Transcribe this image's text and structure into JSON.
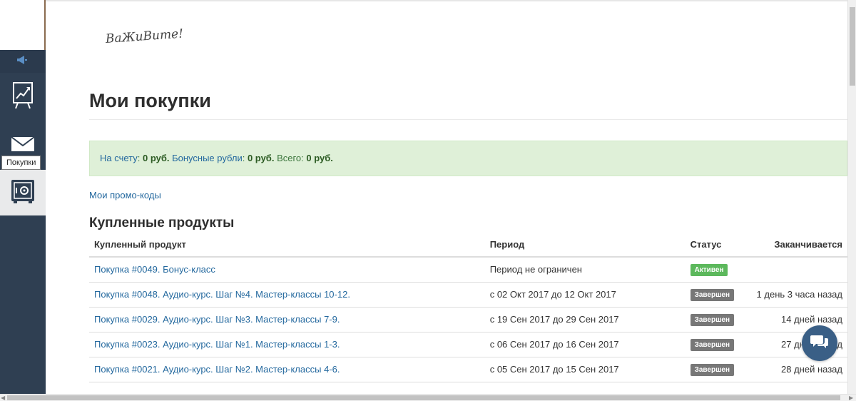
{
  "sidebar": {
    "tooltip": "Покупки",
    "icons": [
      "megaphone-icon",
      "chart-board-icon",
      "envelope-icon",
      "safe-icon"
    ]
  },
  "header": {
    "logo_text": "ВаЖиВите!"
  },
  "page": {
    "title": "Мои покупки"
  },
  "balance": {
    "account_label": "На счету",
    "account_value": "0 руб.",
    "bonus_label": "Бонусные рубли",
    "bonus_value": "0 руб.",
    "total_label": "Всего:",
    "total_value": "0 руб."
  },
  "promo_link": "Мои промо-коды",
  "purchases": {
    "section_title": "Купленные продукты",
    "columns": [
      "Купленный продукт",
      "Период",
      "Статус",
      "Заканчивается"
    ],
    "rows": [
      {
        "product": "Покупка #0049. Бонус-класс",
        "period": "Период не ограничен",
        "status": "Активен",
        "status_type": "active",
        "ends": ""
      },
      {
        "product": "Покупка #0048. Аудио-курс. Шаг №4. Мастер-классы 10-12.",
        "period": "с 02 Окт 2017 до 12 Окт 2017",
        "status": "Завершен",
        "status_type": "done",
        "ends": "1 день 3 часа назад"
      },
      {
        "product": "Покупка #0029. Аудио-курс. Шаг №3. Мастер-классы 7-9.",
        "period": "с 19 Сен 2017 до 29 Сен 2017",
        "status": "Завершен",
        "status_type": "done",
        "ends": "14 дней назад"
      },
      {
        "product": "Покупка #0023. Аудио-курс. Шаг №1. Мастер-классы 1-3.",
        "period": "с 06 Сен 2017 до 16 Сен 2017",
        "status": "Завершен",
        "status_type": "done",
        "ends": "27 дней назад"
      },
      {
        "product": "Покупка #0021. Аудио-курс. Шаг №2. Мастер-классы 4-6.",
        "period": "с 05 Сен 2017 до 15 Сен 2017",
        "status": "Завершен",
        "status_type": "done",
        "ends": "28 дней назад"
      }
    ]
  },
  "colors": {
    "sidebar_bg": "#2f3f52",
    "link": "#23689e",
    "success_bg": "#dff0d8",
    "badge_active": "#5cb85c",
    "badge_done": "#777777",
    "chat_button": "#3a5f86"
  },
  "chat": {
    "icon": "chat-bubbles-icon"
  }
}
